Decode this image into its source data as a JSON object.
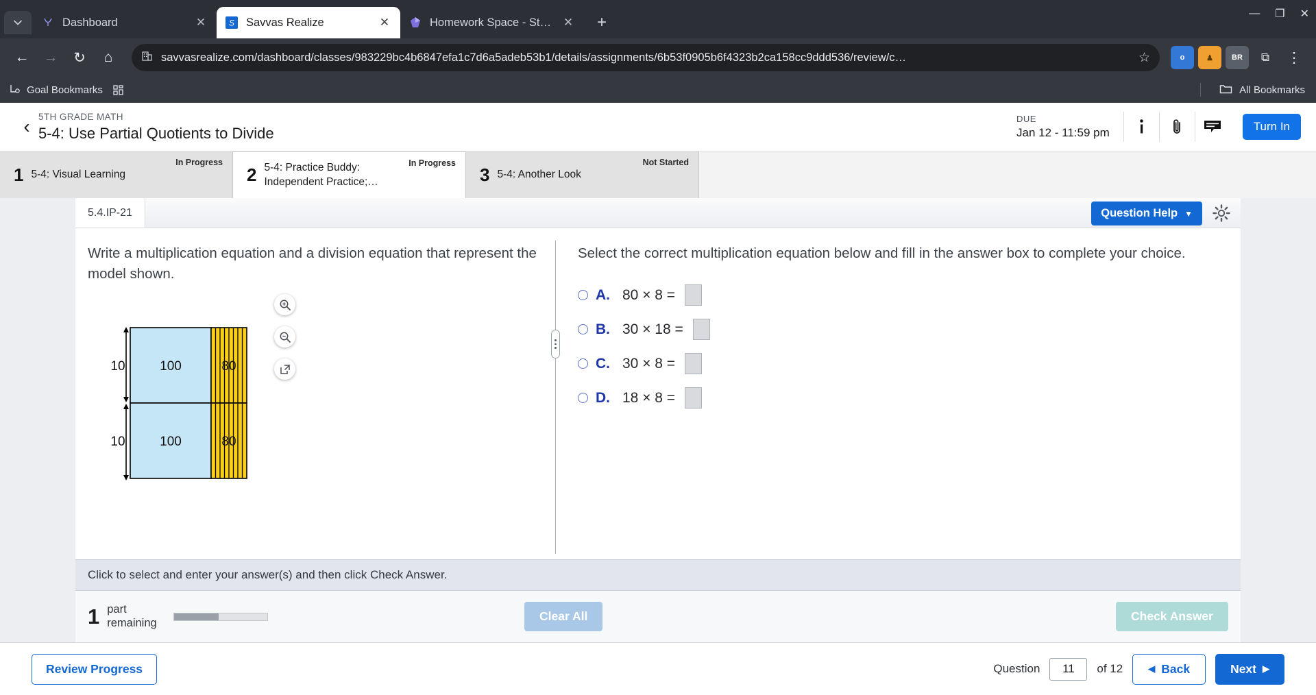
{
  "browser": {
    "tabs": [
      {
        "title": "Dashboard",
        "favicon": "deer-icon",
        "active": false,
        "close_label": "✕"
      },
      {
        "title": "Savvas Realize",
        "favicon": "savvas-logo-icon",
        "active": true,
        "close_label": "✕"
      },
      {
        "title": "Homework Space - StudyX",
        "favicon": "studyx-logo-icon",
        "active": false,
        "close_label": "✕"
      }
    ],
    "new_tab_label": "+",
    "window_controls": {
      "minimize": "—",
      "maximize": "❐",
      "close": "✕"
    },
    "nav": {
      "back": "←",
      "forward": "→",
      "reload": "↻",
      "home": "⌂"
    },
    "url": "savvasrealize.com/dashboard/classes/983229bc4b6847efa1c7d6a5adeb53b1/details/assignments/6b53f0905b6f4323b2ca158cc9ddd536/review/c…",
    "star_label": "☆",
    "extensions": [
      {
        "name": "extension-o-icon",
        "label": "o",
        "color": "#3478d6"
      },
      {
        "name": "extension-orange-icon",
        "label": "♟",
        "color": "#f0a030"
      },
      {
        "name": "extension-br-icon",
        "label": "BR",
        "color": "#5a6069"
      },
      {
        "name": "extension-sidepanel-icon",
        "label": "⧉",
        "color": "#55595f"
      }
    ],
    "menu_label": "⋮",
    "bookmarks": {
      "items": [
        {
          "label": "Goal Bookmarks",
          "icon": "folder-gear-icon"
        }
      ],
      "apps_icon": "apps-grid-icon",
      "all_bookmarks_label": "All Bookmarks",
      "all_bookmarks_icon": "folder-icon"
    }
  },
  "assignment": {
    "back_icon": "chevron-left-icon",
    "eyebrow": "5TH GRADE MATH",
    "title": "5-4: Use Partial Quotients to Divide",
    "due_label": "DUE",
    "due_value": "Jan 12 - 11:59 pm",
    "icons": [
      {
        "name": "info-icon",
        "glyph": "ℹ"
      },
      {
        "name": "attachment-icon",
        "glyph": "📎"
      },
      {
        "name": "comment-icon",
        "glyph": "💬"
      }
    ],
    "turn_in_label": "Turn In",
    "accent_color": "#1272e8"
  },
  "lesson_tabs": [
    {
      "num": "1",
      "label": "5-4: Visual Learning",
      "status": "In Progress",
      "active": false
    },
    {
      "num": "2",
      "label": "5-4: Practice Buddy: Independent Practice;…",
      "status": "In Progress",
      "active": true
    },
    {
      "num": "3",
      "label": "5-4: Another Look",
      "status": "Not Started",
      "active": false
    }
  ],
  "question": {
    "id": "5.4.IP-21",
    "help_label": "Question Help",
    "help_caret": "▼",
    "settings_icon": "gear-icon",
    "left_text": "Write a multiplication equation and a division equation that represent the model shown.",
    "zoom_tools": [
      {
        "name": "zoom-in-icon",
        "glyph": "⌕"
      },
      {
        "name": "zoom-out-icon",
        "glyph": "⌕"
      },
      {
        "name": "open-external-icon",
        "glyph": "↗"
      }
    ],
    "prompt": "Select the correct multiplication equation below and fill in the answer box to complete your choice.",
    "choices": [
      {
        "letter": "A.",
        "expr": "80 × 8 =",
        "selected": false
      },
      {
        "letter": "B.",
        "expr": "30 × 18 =",
        "selected": false
      },
      {
        "letter": "C.",
        "expr": "30 × 8 =",
        "selected": false
      },
      {
        "letter": "D.",
        "expr": "18 × 8 =",
        "selected": false
      }
    ],
    "hint": "Click to select and enter your answer(s) and then click Check Answer.",
    "parts_number": "1",
    "parts_label_line1": "part",
    "parts_label_line2": "remaining",
    "progress_percent": 48,
    "clear_all_label": "Clear All",
    "check_answer_label": "Check Answer"
  },
  "model_diagram": {
    "row_labels": [
      "10",
      "10"
    ],
    "blue_cell_value": "100",
    "yellow_cell_value": "80",
    "blue_color": "#c5e6f7",
    "yellow_color": "#f9cf18",
    "yellow_stripe_count": 8
  },
  "footer": {
    "review_progress_label": "Review Progress",
    "question_label": "Question",
    "question_number": "11",
    "of_label": "of 12",
    "back_label": "Back",
    "back_arrow": "◀",
    "next_label": "Next",
    "next_arrow": "▶"
  }
}
